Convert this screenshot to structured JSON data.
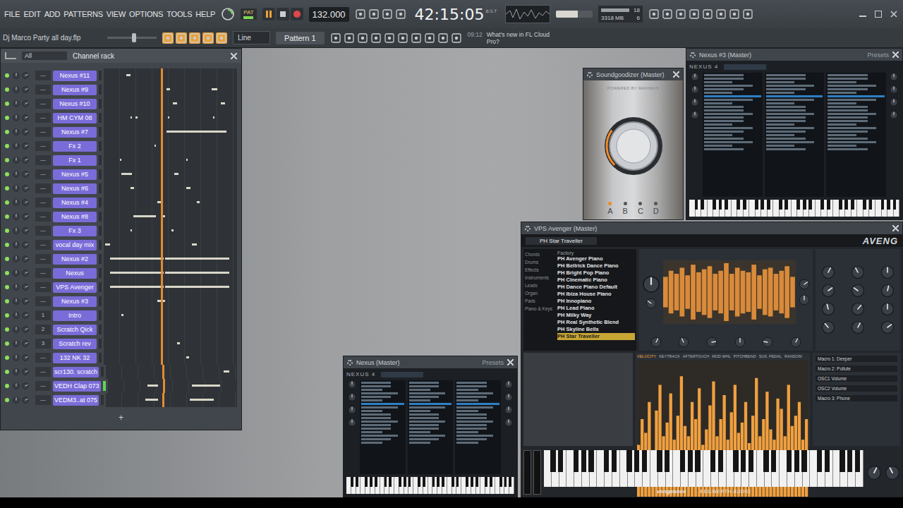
{
  "window": {
    "project": "Dj Marco Party all day.flp"
  },
  "menu": [
    "FILE",
    "EDIT",
    "ADD",
    "PATTERNS",
    "VIEW",
    "OPTIONS",
    "TOOLS",
    "HELP"
  ],
  "transport": {
    "mode": "PAT",
    "playing": true,
    "tempo": "132.000",
    "time": "42:15:05",
    "time_unit": "B:S:T",
    "cpu": "18",
    "memory": "3318 MB",
    "polyphony": "6"
  },
  "toolbar": {
    "snap": "Line",
    "pattern": "Pattern 1",
    "hint_time": "09:12",
    "hint": "What's new in FL Cloud Pro?"
  },
  "channel_rack": {
    "title": "Channel rack",
    "filter": "All",
    "add": "+",
    "playhead": 0.43,
    "channels": [
      {
        "name": "Nexus #11",
        "track": "---",
        "on": true,
        "selected": false,
        "notes": [
          [
            0.17,
            0.03
          ]
        ]
      },
      {
        "name": "Nexus #9",
        "track": "---",
        "on": true,
        "selected": false,
        "notes": [
          [
            0.47,
            0.03
          ],
          [
            0.81,
            0.04
          ]
        ]
      },
      {
        "name": "Nexus #10",
        "track": "---",
        "on": true,
        "selected": false,
        "notes": [
          [
            0.52,
            0.03
          ],
          [
            0.88,
            0.03
          ]
        ]
      },
      {
        "name": "HM CYM 08",
        "track": "---",
        "on": true,
        "selected": false,
        "notes": [
          [
            0.2,
            0.01
          ],
          [
            0.24,
            0.01
          ],
          [
            0.48,
            0.01
          ],
          [
            0.82,
            0.01
          ]
        ]
      },
      {
        "name": "Nexus #7",
        "track": "---",
        "on": true,
        "selected": false,
        "notes": [
          [
            0.47,
            0.45
          ]
        ]
      },
      {
        "name": "Fx 2",
        "track": "---",
        "on": true,
        "selected": false,
        "notes": [
          [
            0.38,
            0.01
          ]
        ]
      },
      {
        "name": "Fx 1",
        "track": "---",
        "on": true,
        "selected": false,
        "notes": [
          [
            0.12,
            0.01
          ],
          [
            0.62,
            0.01
          ]
        ]
      },
      {
        "name": "Nexus #5",
        "track": "---",
        "on": true,
        "selected": false,
        "notes": [
          [
            0.13,
            0.08
          ],
          [
            0.53,
            0.03
          ]
        ]
      },
      {
        "name": "Nexus #6",
        "track": "---",
        "on": true,
        "selected": false,
        "notes": [
          [
            0.2,
            0.03
          ],
          [
            0.62,
            0.03
          ]
        ]
      },
      {
        "name": "Nexus #4",
        "track": "---",
        "on": true,
        "selected": false,
        "notes": [
          [
            0.4,
            0.03
          ],
          [
            0.7,
            0.02
          ]
        ]
      },
      {
        "name": "Nexus #8",
        "track": "---",
        "on": true,
        "selected": false,
        "notes": [
          [
            0.22,
            0.17
          ],
          [
            0.44,
            0.02
          ]
        ]
      },
      {
        "name": "Fx 3",
        "track": "---",
        "on": true,
        "selected": false,
        "notes": [
          [
            0.2,
            0.01
          ],
          [
            0.51,
            0.01
          ]
        ]
      },
      {
        "name": "vocal day mix",
        "track": "---",
        "on": true,
        "selected": false,
        "notes": [
          [
            0.01,
            0.04
          ],
          [
            0.66,
            0.04
          ]
        ]
      },
      {
        "name": "Nexus #2",
        "track": "---",
        "on": true,
        "selected": false,
        "notes": [
          [
            0.05,
            0.4
          ],
          [
            0.46,
            0.48
          ]
        ]
      },
      {
        "name": "Nexus",
        "track": "---",
        "on": true,
        "selected": false,
        "notes": [
          [
            0.05,
            0.4
          ],
          [
            0.46,
            0.48
          ]
        ]
      },
      {
        "name": "VPS Avenger",
        "track": "---",
        "on": true,
        "selected": false,
        "notes": [
          [
            0.05,
            0.4
          ],
          [
            0.46,
            0.48
          ]
        ]
      },
      {
        "name": "Nexus #3",
        "track": "---",
        "on": true,
        "selected": false,
        "notes": [
          [
            0.4,
            0.06
          ]
        ]
      },
      {
        "name": "Intro",
        "track": "1",
        "on": true,
        "selected": false,
        "notes": [
          [
            0.13,
            0.02
          ]
        ]
      },
      {
        "name": "Scratch Qick",
        "track": "2",
        "on": true,
        "selected": false,
        "notes": []
      },
      {
        "name": "Scratch rev",
        "track": "3",
        "on": true,
        "selected": false,
        "notes": [
          [
            0.55,
            0.02
          ]
        ]
      },
      {
        "name": "132 NK 32",
        "track": "---",
        "on": true,
        "selected": false,
        "notes": [
          [
            0.62,
            0.02
          ]
        ]
      },
      {
        "name": "scr130. scratch",
        "track": "---",
        "on": true,
        "selected": false,
        "notes": [
          [
            0.9,
            0.04
          ]
        ]
      },
      {
        "name": "VEDH Clap 073",
        "track": "---",
        "on": true,
        "selected": true,
        "notes": [
          [
            0.31,
            0.08
          ],
          [
            0.65,
            0.22
          ]
        ]
      },
      {
        "name": "VEDM3..at 075",
        "track": "---",
        "on": true,
        "selected": false,
        "notes": [
          [
            0.3,
            0.1
          ],
          [
            0.64,
            0.18
          ]
        ]
      }
    ]
  },
  "soundgoodizer": {
    "title": "Soundgoodizer (Master)",
    "brand": "POWERED BY MAXIMUS",
    "level": 0.3,
    "modes": [
      {
        "label": "A",
        "selected": true
      },
      {
        "label": "B",
        "selected": false
      },
      {
        "label": "C",
        "selected": false
      },
      {
        "label": "D",
        "selected": false
      }
    ]
  },
  "nexus3": {
    "title": "Nexus #3 (Master)",
    "presets": "Presets",
    "logo": "NEXUS 4"
  },
  "nexus": {
    "title": "Nexus (Master)",
    "presets": "Presets",
    "logo": "NEXUS 4"
  },
  "avenger": {
    "title": "VPS Avenger (Master)",
    "preset": "PH Star Traveller",
    "logo": "AVENG",
    "brand": "vengeance",
    "maker": "KEILWERTH AUDIO",
    "folder": "Factory",
    "categories": [
      "Chords",
      "Drums",
      "Effects",
      "Instruments",
      "Leads",
      "Organ",
      "Pads",
      "Piano & Keys"
    ],
    "presets": [
      {
        "name": "PH Avenger Piano",
        "selected": false
      },
      {
        "name": "PH Bellrick Dance Piano",
        "selected": false
      },
      {
        "name": "PH Bright Pop Piano",
        "selected": false
      },
      {
        "name": "PH Cinematic Piano",
        "selected": false
      },
      {
        "name": "PH Dance Piano Default",
        "selected": false
      },
      {
        "name": "PH Ibiza House Piano",
        "selected": false
      },
      {
        "name": "PH Innopiano",
        "selected": false
      },
      {
        "name": "PH Lead Piano",
        "selected": false
      },
      {
        "name": "PH Milky Way",
        "selected": false
      },
      {
        "name": "PH Real Synthetic Blend",
        "selected": false
      },
      {
        "name": "PH Skyline Bells",
        "selected": false
      },
      {
        "name": "PH Star Traveller",
        "selected": true
      }
    ],
    "osc_wave": [
      0.5,
      0.7,
      0.6,
      0.8,
      0.55,
      0.9,
      0.65,
      0.75,
      0.85,
      0.6,
      0.7,
      0.95,
      0.6,
      0.8,
      0.7,
      0.65,
      0.9,
      0.55,
      0.75,
      0.8,
      0.6,
      0.7,
      0.85,
      0.5
    ],
    "wave": [
      0.55,
      0.7,
      0.62,
      0.8,
      0.5,
      0.75,
      0.9,
      0.6,
      0.68,
      0.85,
      0.58,
      0.72,
      0.95,
      0.66,
      0.6,
      0.8,
      0.7,
      0.88,
      0.55,
      0.64,
      0.78,
      0.92,
      0.6,
      0.7,
      0.84,
      0.58,
      0.74,
      0.9,
      0.62,
      0.68,
      0.8,
      0.56,
      0.72,
      0.94,
      0.6,
      0.7,
      0.86,
      0.64,
      0.58,
      0.82,
      0.76,
      0.6,
      0.9,
      0.66,
      0.72,
      0.8,
      0.58,
      0.7
    ],
    "knobs_top": [
      0.5,
      0.3,
      0.7,
      0.5,
      0.6,
      0.4,
      0.8,
      0.5,
      0.2,
      0.6
    ],
    "knobs_right": [
      0.6,
      0.4,
      0.5,
      0.7,
      0.3,
      0.55,
      0.45,
      0.65,
      0.5,
      0.35,
      0.6,
      0.7
    ],
    "knobs_bottom": [
      0.5,
      0.4,
      0.6,
      0.5,
      0.3,
      0.7,
      0.5,
      0.45,
      0.6
    ],
    "mod_tabs": [
      "VELOCITY",
      "KEYTRACK",
      "AFTERTOUCH",
      "MOD WHL",
      "PITCHBEND",
      "SUS. PEDAL",
      "RANDOM"
    ],
    "macros": [
      "Macro 1: Deeper",
      "Macro 2: Pollute",
      "OSC1 Volume",
      "OSC2 Volume",
      "Macro 3: Phone"
    ]
  }
}
